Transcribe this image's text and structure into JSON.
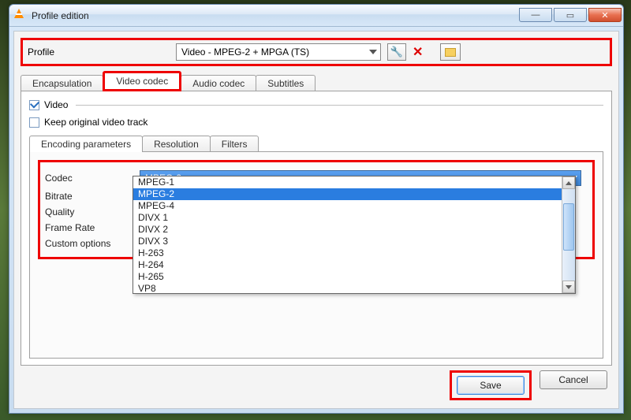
{
  "window": {
    "title": "Profile edition"
  },
  "profile": {
    "label": "Profile",
    "selected": "Video - MPEG-2 + MPGA (TS)"
  },
  "tabs": {
    "encapsulation": "Encapsulation",
    "video_codec": "Video codec",
    "audio_codec": "Audio codec",
    "subtitles": "Subtitles"
  },
  "video_checkbox": "Video",
  "keep_original": "Keep original video track",
  "subtabs": {
    "encoding": "Encoding parameters",
    "resolution": "Resolution",
    "filters": "Filters"
  },
  "form": {
    "codec_label": "Codec",
    "codec_selected": "MPEG-2",
    "bitrate_label": "Bitrate",
    "quality_label": "Quality",
    "frame_rate_label": "Frame Rate",
    "custom_options_label": "Custom options"
  },
  "codec_options": [
    "MPEG-1",
    "MPEG-2",
    "MPEG-4",
    "DIVX 1",
    "DIVX 2",
    "DIVX 3",
    "H-263",
    "H-264",
    "H-265",
    "VP8"
  ],
  "codec_highlighted_index": 1,
  "buttons": {
    "save": "Save",
    "cancel": "Cancel"
  }
}
